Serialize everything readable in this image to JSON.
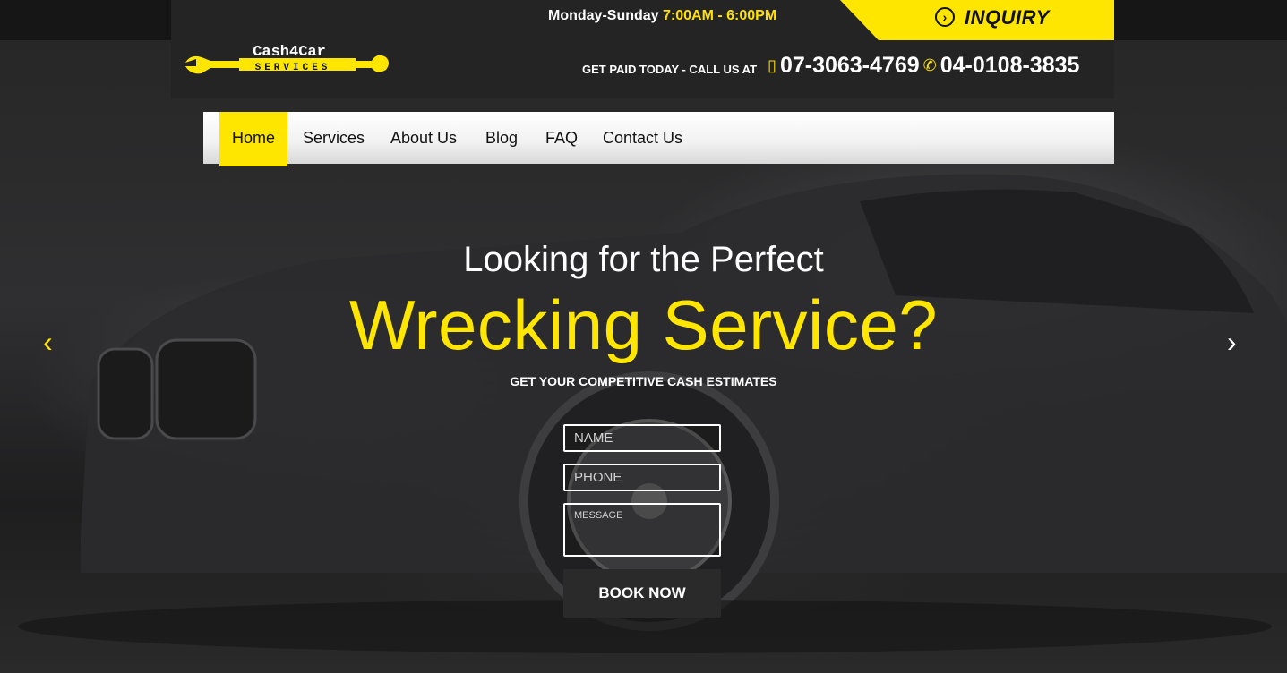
{
  "topbar": {
    "hours_days": "Monday-Sunday ",
    "hours_time": "7:00AM - 6:00PM",
    "inquiry_label": "INQUIRY"
  },
  "logo": {
    "line1": "Cash4Car",
    "line2": "SERVICES"
  },
  "contact": {
    "call_label": "GET PAID TODAY - CALL US AT",
    "phone1": "07-3063-4769",
    "phone2": "04-0108-3835"
  },
  "nav": {
    "items": [
      {
        "label": "Home",
        "active": true
      },
      {
        "label": "Services"
      },
      {
        "label": "About Us"
      },
      {
        "label": "Blog"
      },
      {
        "label": "FAQ"
      },
      {
        "label": "Contact Us"
      }
    ]
  },
  "hero": {
    "line1": "Looking for the Perfect",
    "line2": "Wrecking Service?",
    "subtitle": "GET YOUR COMPETITIVE CASH ESTIMATES",
    "prev_arrow": "‹",
    "next_arrow": "›"
  },
  "form": {
    "name_placeholder": "NAME",
    "phone_placeholder": "PHONE",
    "message_placeholder": "MESSAGE",
    "submit_label": "BOOK NOW"
  },
  "colors": {
    "accent": "#ffe600",
    "dark": "#242424"
  }
}
